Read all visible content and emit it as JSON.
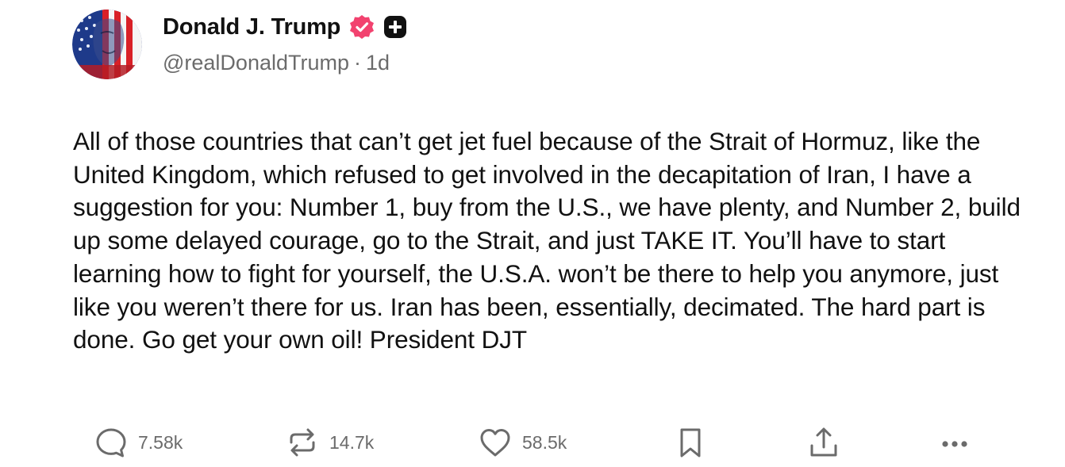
{
  "author": {
    "display_name": "Donald J. Trump",
    "handle": "@realDonaldTrump",
    "separator": "·",
    "time_ago": "1d",
    "verified_icon": "verified-badge-icon",
    "extra_badge_icon": "plus-badge-icon"
  },
  "post": {
    "text": "All of those countries that can’t get jet fuel because of the Strait of Hormuz, like the United Kingdom, which refused to get involved in the decapitation of Iran, I have a suggestion for you: Number 1, buy from the U.S., we have plenty, and Number 2, build up some delayed courage, go to the Strait, and just TAKE IT. You’ll have to start learning how to fight for yourself, the U.S.A. won’t be there to help you anymore, just like you weren’t there for us. Iran has been, essentially, decimated. The hard part is done. Go get your own oil! President DJT"
  },
  "actions": {
    "replies": "7.58k",
    "reposts": "14.7k",
    "likes": "58.5k"
  },
  "colors": {
    "text": "#111111",
    "muted": "#6b6b6b",
    "verified": "#f2426f"
  }
}
